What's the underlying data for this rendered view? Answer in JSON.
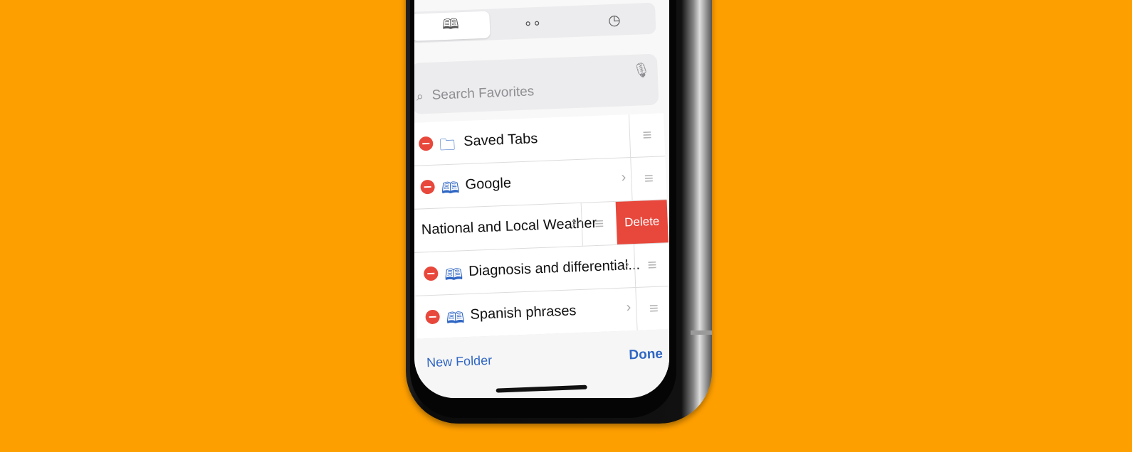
{
  "colors": {
    "background": "#fe9f00",
    "accent": "#2f66c4",
    "destructive": "#e8473b"
  },
  "tabs": [
    {
      "icon": "book-icon",
      "selected": true
    },
    {
      "icon": "glasses-icon",
      "selected": false
    },
    {
      "icon": "clock-icon",
      "selected": false
    }
  ],
  "search": {
    "placeholder": "Search Favorites",
    "icon": "search-icon",
    "mic": "microphone-icon"
  },
  "rows": [
    {
      "label": "Saved Tabs",
      "icon": "folder-icon",
      "chevron": false
    },
    {
      "label": "Google",
      "icon": "book-icon",
      "chevron": true
    },
    {
      "label": "National and Local Weather",
      "icon": "book-icon",
      "chevron": true,
      "swiped": true
    },
    {
      "label": "Diagnosis and differential...",
      "icon": "book-icon",
      "chevron": true
    },
    {
      "label": "Spanish phrases",
      "icon": "book-icon",
      "chevron": true
    }
  ],
  "delete_label": "Delete",
  "toolbar": {
    "new_folder": "New Folder",
    "done": "Done"
  }
}
